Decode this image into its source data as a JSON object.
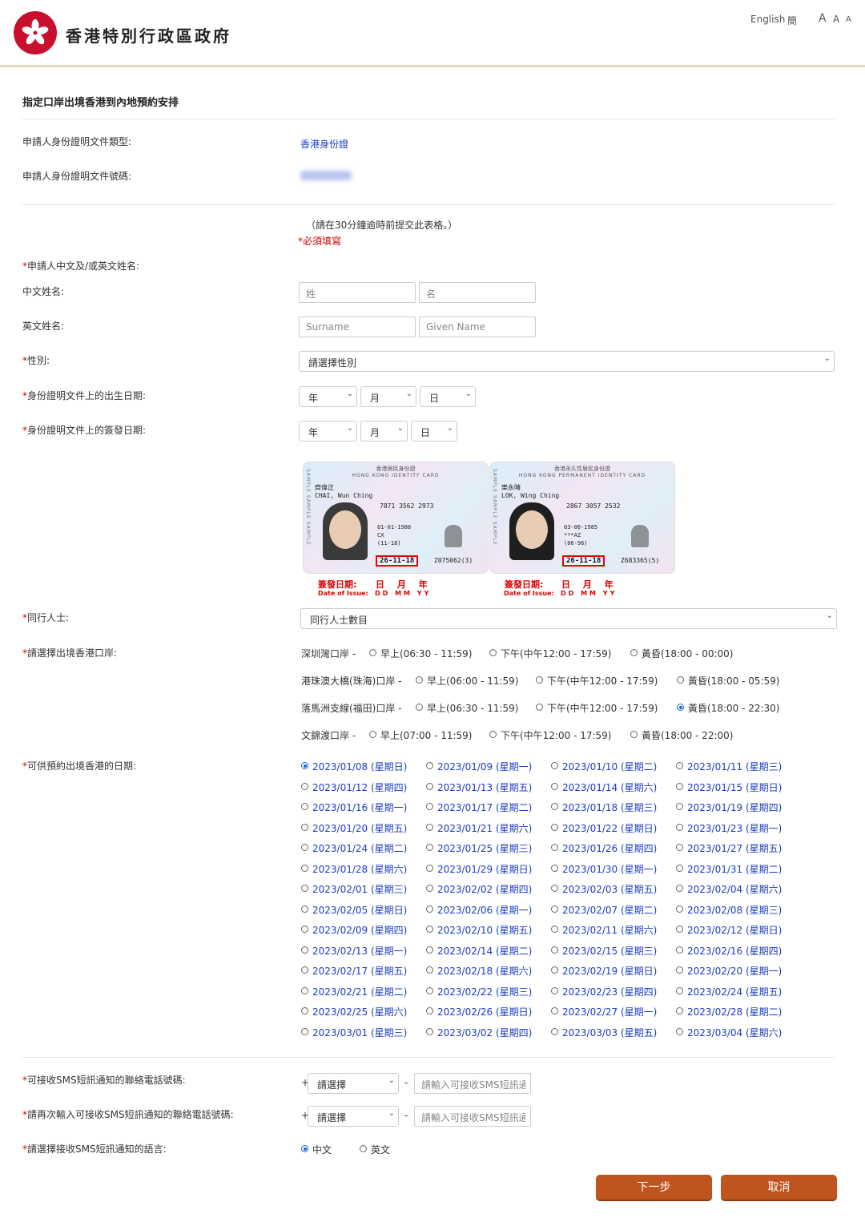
{
  "header": {
    "site_title": "香港特別行政區政府",
    "lang_english": "English",
    "lang_simplified": "簡",
    "font_sizes": [
      "A",
      "A",
      "A"
    ]
  },
  "page": {
    "title": "指定口岸出境香港到內地預約安排",
    "doc_type_label": "申請人身份證明文件類型:",
    "doc_type_value": "香港身份證",
    "doc_no_label": "申請人身份證明文件號碼:",
    "submit_note": "（請在30分鐘逾時前提交此表格。）",
    "required_note": "*必須填寫"
  },
  "form": {
    "name_label": "申請人中文及/或英文姓名:",
    "chinese_name_label": "中文姓名:",
    "chinese_surname_ph": "姓",
    "chinese_given_ph": "名",
    "english_name_label": "英文姓名:",
    "english_surname_ph": "Surname",
    "english_given_ph": "Given Name",
    "gender_label": "性別:",
    "gender_value": "請選擇性別",
    "dob_label": "身份證明文件上的出生日期:",
    "dob_year": "年",
    "dob_month": "月",
    "dob_day": "日",
    "issue_label": "身份證明文件上的簽發日期:",
    "issue_year": "年",
    "issue_month": "月",
    "issue_day": "日",
    "companions_label": "同行人士:",
    "companions_value": "同行人士數目",
    "port_label": "請選擇出境香港口岸:",
    "date_label": "可供預約出境香港的日期:",
    "phone_label": "可接收SMS短訊通知的聯絡電話號碼:",
    "phone_again_label": "請再次輸入可接收SMS短訊通知的聯絡電話號碼:",
    "phone_prefix": "+",
    "phone_dash": "-",
    "phone_code_value": "請選擇",
    "phone_ph": "請輸入可接收SMS短訊通知的聯絡電話號碼",
    "sms_lang_label": "請選擇接收SMS短訊通知的語言:",
    "sms_lang_options": [
      "中文",
      "英文"
    ],
    "sms_lang_selected": 0
  },
  "id_cards": [
    {
      "title_cn": "香港居民身份證",
      "title_en": "HONG KONG IDENTITY CARD",
      "side": "SAMPLE SAMPLE SAMPLE",
      "name_cn": "齊偉正",
      "name_en": "CHAI, Wun Ching",
      "code": "7871 3562 2973",
      "dob": "01-01-1988",
      "extra": "CX",
      "first_issue": "(11-18)",
      "issue_date": "26-11-18",
      "id_no": "Z075062(3)"
    },
    {
      "title_cn": "香港永久性居民身份證",
      "title_en": "HONG KONG PERMANENT IDENTITY CARD",
      "side": "SAMPLE SAMPLE SAMPLE",
      "name_cn": "樂永晴",
      "name_en": "LOK, Wing Ching",
      "code": "2867 3057 2532",
      "dob": "03-06-1985",
      "extra": "***AZ",
      "first_issue": "(06-96)",
      "issue_date": "26-11-18",
      "id_no": "Z683365(5)"
    }
  ],
  "issue_caption": {
    "label_cn": "簽發日期:",
    "label_en": "Date of Issue:",
    "dmy_cn": "日 月 年",
    "dmy_en": "DD MM YY"
  },
  "ports": [
    {
      "name": "深圳灣口岸 -",
      "options": [
        "早上(06:30 - 11:59)",
        "下午(中午12:00 - 17:59)",
        "黃昏(18:00 - 00:00)"
      ],
      "selected": -1
    },
    {
      "name": "港珠澳大橋(珠海)口岸 -",
      "options": [
        "早上(06:00 - 11:59)",
        "下午(中午12:00 - 17:59)",
        "黃昏(18:00 - 05:59)"
      ],
      "selected": -1
    },
    {
      "name": "落馬洲支線(福田)口岸 -",
      "options": [
        "早上(06:30 - 11:59)",
        "下午(中午12:00 - 17:59)",
        "黃昏(18:00 - 22:30)"
      ],
      "selected": 2
    },
    {
      "name": "文錦渡口岸 -",
      "options": [
        "早上(07:00 - 11:59)",
        "下午(中午12:00 - 17:59)",
        "黃昏(18:00 - 22:00)"
      ],
      "selected": -1
    }
  ],
  "dates": [
    "2023/01/08 (星期日)",
    "2023/01/09 (星期一)",
    "2023/01/10 (星期二)",
    "2023/01/11 (星期三)",
    "2023/01/12 (星期四)",
    "2023/01/13 (星期五)",
    "2023/01/14 (星期六)",
    "2023/01/15 (星期日)",
    "2023/01/16 (星期一)",
    "2023/01/17 (星期二)",
    "2023/01/18 (星期三)",
    "2023/01/19 (星期四)",
    "2023/01/20 (星期五)",
    "2023/01/21 (星期六)",
    "2023/01/22 (星期日)",
    "2023/01/23 (星期一)",
    "2023/01/24 (星期二)",
    "2023/01/25 (星期三)",
    "2023/01/26 (星期四)",
    "2023/01/27 (星期五)",
    "2023/01/28 (星期六)",
    "2023/01/29 (星期日)",
    "2023/01/30 (星期一)",
    "2023/01/31 (星期二)",
    "2023/02/01 (星期三)",
    "2023/02/02 (星期四)",
    "2023/02/03 (星期五)",
    "2023/02/04 (星期六)",
    "2023/02/05 (星期日)",
    "2023/02/06 (星期一)",
    "2023/02/07 (星期二)",
    "2023/02/08 (星期三)",
    "2023/02/09 (星期四)",
    "2023/02/10 (星期五)",
    "2023/02/11 (星期六)",
    "2023/02/12 (星期日)",
    "2023/02/13 (星期一)",
    "2023/02/14 (星期二)",
    "2023/02/15 (星期三)",
    "2023/02/16 (星期四)",
    "2023/02/17 (星期五)",
    "2023/02/18 (星期六)",
    "2023/02/19 (星期日)",
    "2023/02/20 (星期一)",
    "2023/02/21 (星期二)",
    "2023/02/22 (星期三)",
    "2023/02/23 (星期四)",
    "2023/02/24 (星期五)",
    "2023/02/25 (星期六)",
    "2023/02/26 (星期日)",
    "2023/02/27 (星期一)",
    "2023/02/28 (星期二)",
    "2023/03/01 (星期三)",
    "2023/03/02 (星期四)",
    "2023/03/03 (星期五)",
    "2023/03/04 (星期六)"
  ],
  "date_selected": 0,
  "buttons": {
    "next": "下一步",
    "cancel": "取消"
  }
}
